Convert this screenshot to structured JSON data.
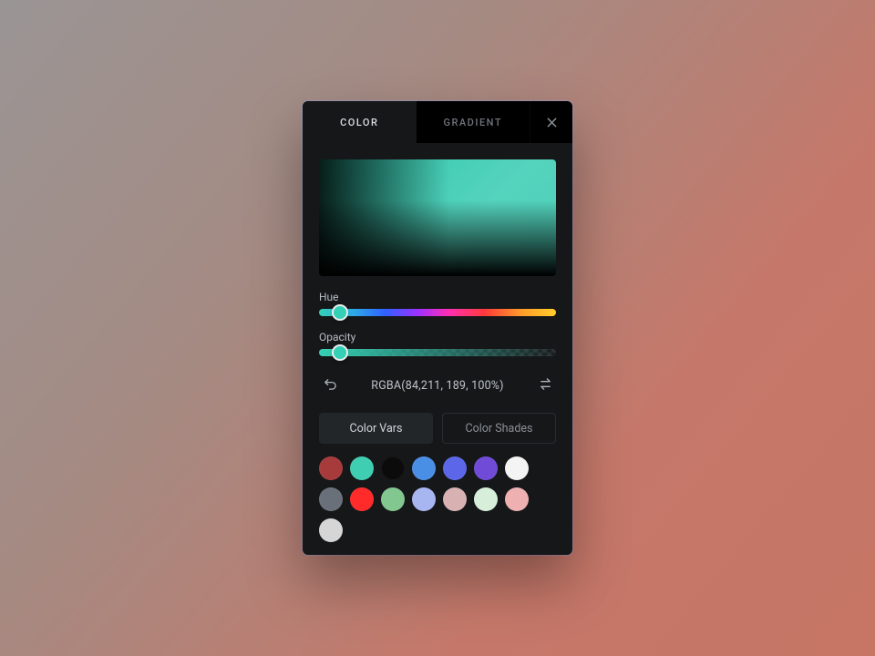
{
  "tabs": {
    "color": "COLOR",
    "gradient": "GRADIENT",
    "active": "color"
  },
  "sliders": {
    "hue": {
      "label": "Hue",
      "knob_pct": 9
    },
    "opacity": {
      "label": "Opacity",
      "knob_pct": 9
    }
  },
  "current_color": {
    "value_string": "RGBA(84,211, 189, 100%)",
    "css": "#34d0b5"
  },
  "subtabs": {
    "vars": "Color Vars",
    "shades": "Color Shades",
    "active": "vars"
  },
  "swatches": [
    "#a73a3a",
    "#3fceb1",
    "#0b0b0b",
    "#4a8fe6",
    "#5b67e8",
    "#6f4bd8",
    "#f4f4f4",
    "#6a7079",
    "#ff2a2a",
    "#82c78f",
    "#a7b5f1",
    "#d8b2b2",
    "#d7efda",
    "#eeb0b0",
    "#d6d6d6"
  ],
  "icons": {
    "close": "close-icon",
    "reset": "undo-icon",
    "swap": "swap-icon"
  }
}
